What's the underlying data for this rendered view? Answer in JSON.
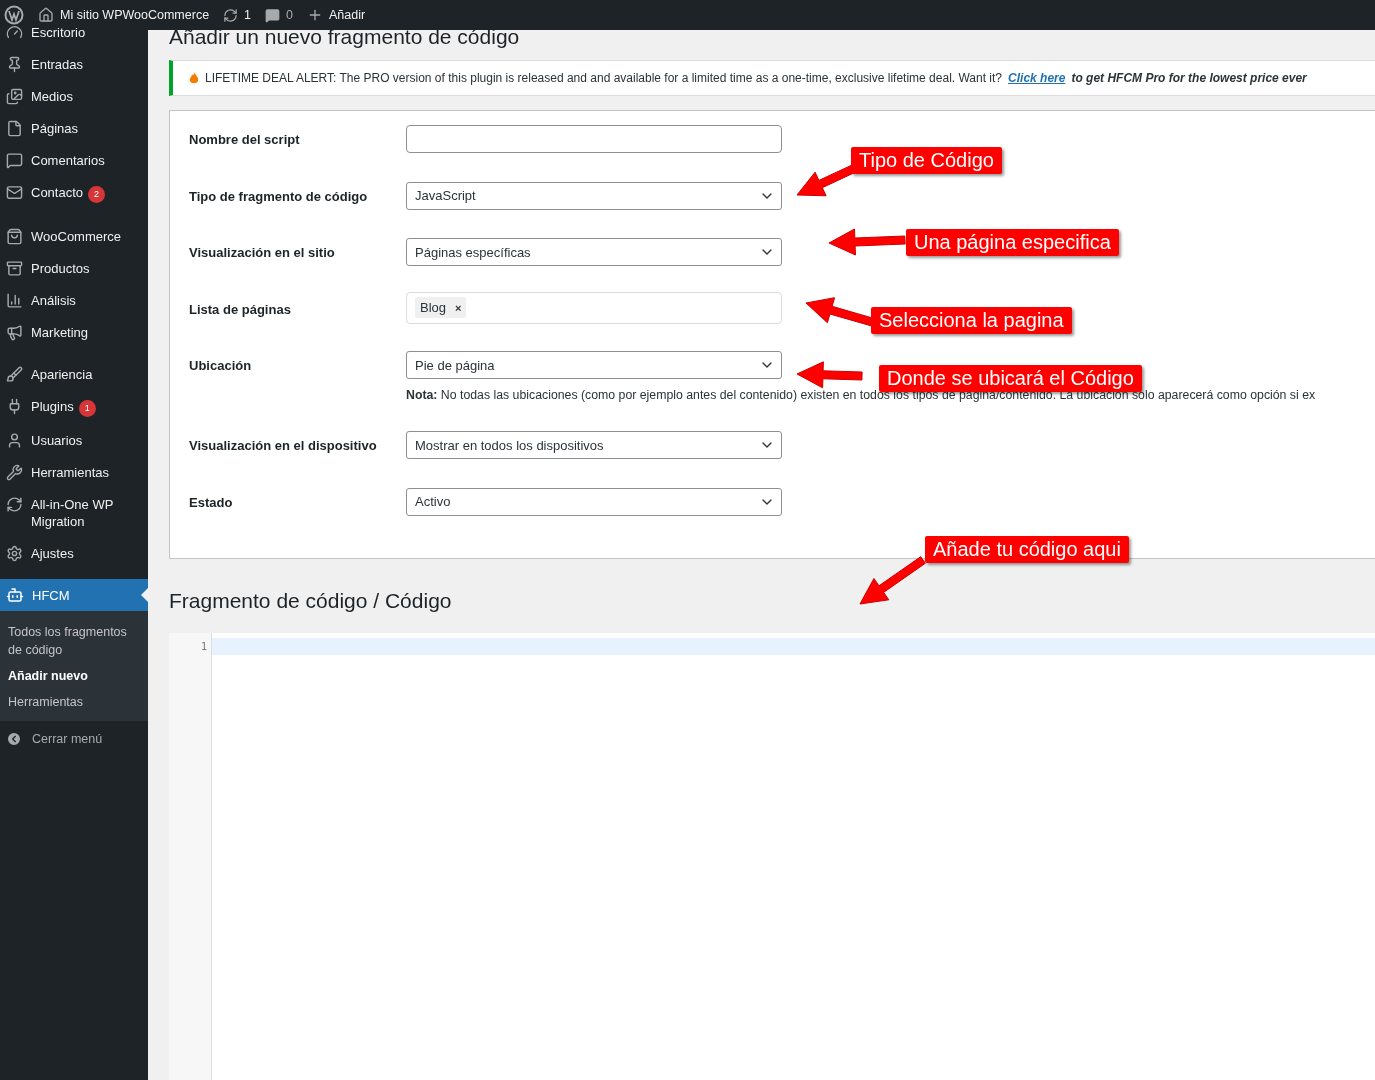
{
  "admin_bar": {
    "site": "Mi sitio WPWooCommerce",
    "updates": "1",
    "comments": "0",
    "new": "Añadir"
  },
  "sidebar": {
    "items": [
      {
        "label": "Escritorio"
      },
      {
        "label": "Entradas"
      },
      {
        "label": "Medios"
      },
      {
        "label": "Páginas"
      },
      {
        "label": "Comentarios"
      },
      {
        "label": "Contacto",
        "badge": "2"
      },
      {
        "label": "WooCommerce"
      },
      {
        "label": "Productos"
      },
      {
        "label": "Análisis"
      },
      {
        "label": "Marketing"
      },
      {
        "label": "Apariencia"
      },
      {
        "label": "Plugins",
        "badge": "1"
      },
      {
        "label": "Usuarios"
      },
      {
        "label": "Herramientas"
      },
      {
        "label": "All-in-One WP Migration"
      },
      {
        "label": "Ajustes"
      }
    ],
    "current": {
      "label": "HFCM",
      "selected": true,
      "submenu": [
        {
          "label": "Todos los fragmentos de código",
          "selected": false
        },
        {
          "label": "Añadir nuevo",
          "selected": true
        },
        {
          "label": "Herramientas",
          "selected": false
        }
      ]
    },
    "collapse": "Cerrar menú"
  },
  "page_title": "Añadir un nuevo fragmento de código",
  "notice": {
    "text": "LIFETIME DEAL ALERT: The PRO version of this plugin is released and and available for a limited time as a one-time, exclusive lifetime deal. Want it?",
    "link": "Click here",
    "tail": "to get HFCM Pro for the lowest price ever"
  },
  "form": [
    {
      "kind": "text",
      "label": "Nombre del script"
    },
    {
      "kind": "select",
      "label": "Tipo de fragmento de código",
      "value": "JavaScript"
    },
    {
      "kind": "select",
      "label": "Visualización en el sitio",
      "value": "Páginas específicas"
    },
    {
      "kind": "tags",
      "label": "Lista de páginas",
      "tags": [
        "Blog"
      ],
      "remove": "×"
    },
    {
      "kind": "select",
      "label": "Ubicación",
      "value": "Pie de página",
      "note_label": "Nota:",
      "note": "No todas las ubicaciones (como por ejemplo antes del contenido) existen en todos los tipos de página/contenido. La ubicación solo aparecerá como opción si ex"
    },
    {
      "kind": "select",
      "label": "Visualización en el dispositivo",
      "value": "Mostrar en todos los dispositivos"
    },
    {
      "kind": "select",
      "label": "Estado",
      "value": "Activo"
    }
  ],
  "code_section": {
    "title": "Fragmento de código / Código",
    "line_numbers": [
      "1"
    ]
  },
  "annotations": [
    {
      "text": "Tipo de Código"
    },
    {
      "text": "Una página especifica"
    },
    {
      "text": "Selecciona la pagina"
    },
    {
      "text": "Donde se ubicará el Código"
    },
    {
      "text": "Añade tu código aqui"
    }
  ]
}
